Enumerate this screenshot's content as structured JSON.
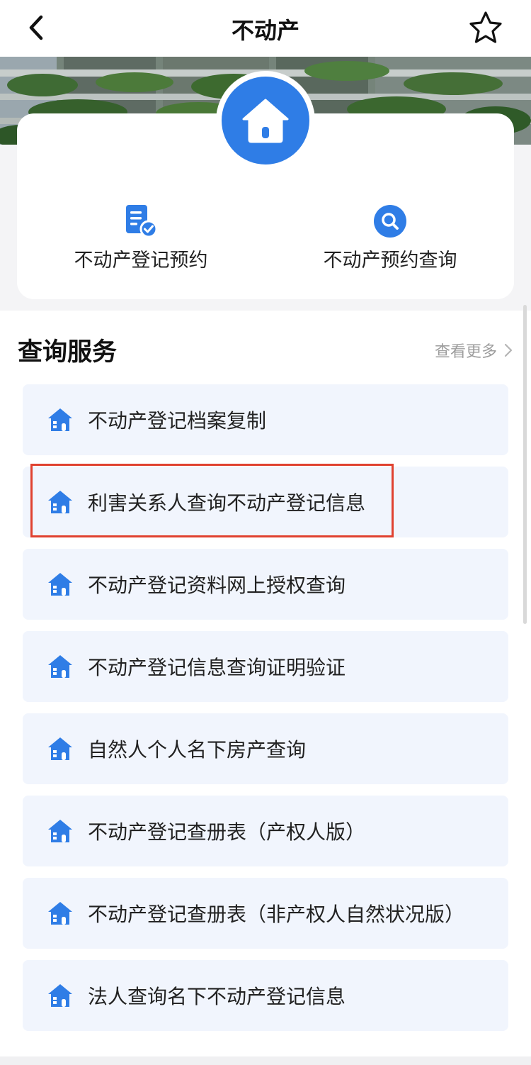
{
  "nav": {
    "title": "不动产",
    "back_icon": "chevron-left-icon",
    "favorite_icon": "star-outline-icon"
  },
  "banner": {
    "logo_icon": "house-icon"
  },
  "quick_actions": [
    {
      "label": "不动产登记预约",
      "icon": "document-check-icon"
    },
    {
      "label": "不动产预约查询",
      "icon": "search-icon"
    }
  ],
  "section": {
    "title": "查询服务",
    "more_label": "查看更多",
    "more_icon": "chevron-right-icon"
  },
  "services": [
    {
      "label": "不动产登记档案复制",
      "icon": "house-icon"
    },
    {
      "label": "利害关系人查询不动产登记信息",
      "icon": "house-icon",
      "highlighted": true
    },
    {
      "label": "不动产登记资料网上授权查询",
      "icon": "house-icon"
    },
    {
      "label": "不动产登记信息查询证明验证",
      "icon": "house-icon"
    },
    {
      "label": "自然人个人名下房产查询",
      "icon": "house-icon"
    },
    {
      "label": "不动产登记查册表（产权人版）",
      "icon": "house-icon"
    },
    {
      "label": "不动产登记查册表（非产权人自然状况版）",
      "icon": "house-icon"
    },
    {
      "label": "法人查询名下不动产登记信息",
      "icon": "house-icon"
    }
  ],
  "colors": {
    "accent": "#2f7de6",
    "highlight_border": "#e0412f",
    "item_background": "#f1f5fd"
  }
}
